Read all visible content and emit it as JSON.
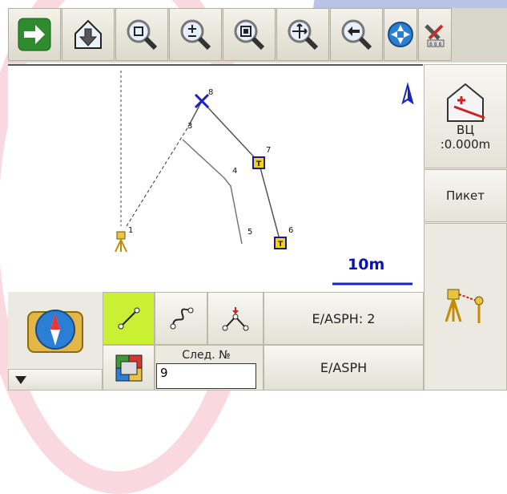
{
  "toolbar": {
    "buttons": [
      {
        "name": "next-icon",
        "color": "#2e8b2e"
      },
      {
        "name": "download-icon"
      },
      {
        "name": "zoom-extents-icon"
      },
      {
        "name": "zoom-in-out-icon"
      },
      {
        "name": "zoom-window-icon"
      },
      {
        "name": "pan-icon"
      },
      {
        "name": "zoom-previous-icon"
      },
      {
        "name": "navigation-icon"
      },
      {
        "name": "tools-icon"
      }
    ]
  },
  "map": {
    "points": [
      {
        "label": "1"
      },
      {
        "label": "3"
      },
      {
        "label": "4"
      },
      {
        "label": "5"
      },
      {
        "label": "6"
      },
      {
        "label": "7"
      },
      {
        "label": "8"
      }
    ],
    "scale_label": "10m",
    "north_icon": "north-arrow-icon",
    "accent_color": "#0a12b0"
  },
  "side": {
    "height_label": "ВЦ",
    "height_value": ":0.000m",
    "picket_label": "Пикет"
  },
  "bottom": {
    "code_button_1": "E/ASPH: 2",
    "code_button_2": "E/ASPH",
    "next_label": "След. №",
    "next_value": "9"
  }
}
